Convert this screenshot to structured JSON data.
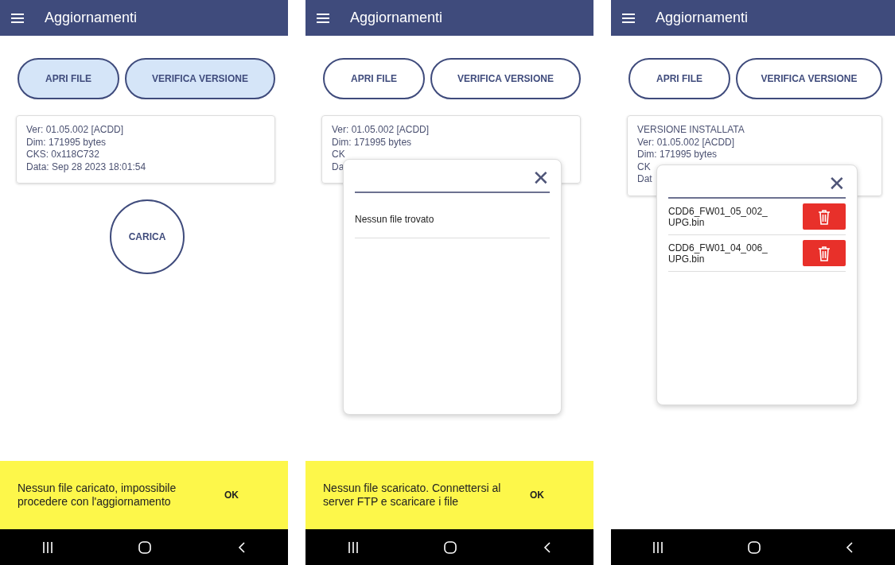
{
  "screens": [
    {
      "app_bar": {
        "title": "Aggiornamenti"
      },
      "buttons": [
        {
          "label": "APRI FILE",
          "highlighted": true
        },
        {
          "label": "VERIFICA VERSIONE",
          "highlighted": true
        }
      ],
      "info_lines": [
        "Ver: 01.05.002 [ACDD]",
        "Dim: 171995 bytes",
        "CKS: 0x118C732",
        "Data: Sep 28 2023 18:01:54"
      ],
      "load_button": "CARICA",
      "snackbar": {
        "message": "Nessun file caricato, impossibile procedere con l'aggiornamento",
        "action": "OK"
      }
    },
    {
      "app_bar": {
        "title": "Aggiornamenti"
      },
      "buttons": [
        {
          "label": "APRI FILE",
          "highlighted": false
        },
        {
          "label": "VERIFICA VERSIONE",
          "highlighted": false
        }
      ],
      "info_lines": [
        "Ver: 01.05.002 [ACDD]",
        "Dim: 171995 bytes",
        "CK",
        "Da"
      ],
      "dialog": {
        "close": "✕",
        "items": [
          {
            "kind": "message",
            "text": "Nessun file trovato"
          }
        ]
      },
      "snackbar": {
        "message": "Nessun file scaricato. Connettersi al server FTP e scaricare i file",
        "action": "OK"
      }
    },
    {
      "app_bar": {
        "title": "Aggiornamenti"
      },
      "buttons": [
        {
          "label": "APRI FILE",
          "highlighted": false
        },
        {
          "label": "VERIFICA VERSIONE",
          "highlighted": false
        }
      ],
      "info_lines": [
        "VERSIONE INSTALLATA",
        "Ver: 01.05.002 [ACDD]",
        "Dim: 171995 bytes",
        "CK",
        "Dat"
      ],
      "dialog": {
        "close": "✕",
        "items": [
          {
            "kind": "file",
            "text": "CDD6_FW01_05_002_\nUPG.bin"
          },
          {
            "kind": "file",
            "text": "CDD6_FW01_04_006_\nUPG.bin"
          }
        ]
      }
    }
  ]
}
